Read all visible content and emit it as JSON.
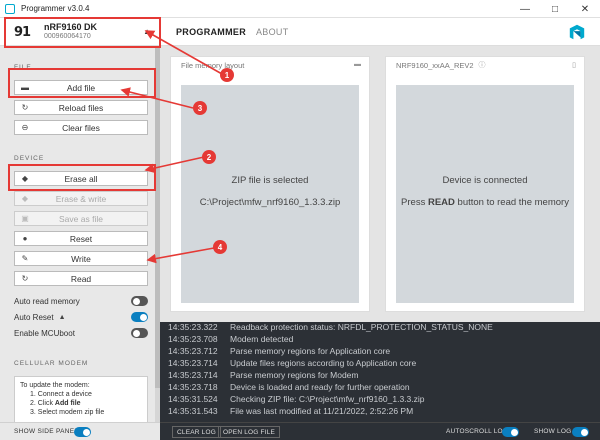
{
  "window": {
    "title": "Programmer v3.0.4",
    "controls": [
      "—",
      "□",
      "✕"
    ]
  },
  "device": {
    "logo": "91",
    "name": "nRF9160 DK",
    "serial": "000960064170"
  },
  "nav": {
    "tabs": [
      {
        "label": "PROGRAMMER",
        "active": true
      },
      {
        "label": "ABOUT",
        "active": false
      }
    ]
  },
  "sidebar": {
    "file_label": "FILE",
    "file_buttons": [
      {
        "label": "Add file",
        "icon": "folder-icon"
      },
      {
        "label": "Reload files",
        "icon": "reload-icon"
      },
      {
        "label": "Clear files",
        "icon": "clear-icon"
      }
    ],
    "device_label": "DEVICE",
    "device_buttons": [
      {
        "label": "Erase all",
        "icon": "eraser-icon",
        "disabled": false
      },
      {
        "label": "Erase & write",
        "icon": "eraser-icon",
        "disabled": true
      },
      {
        "label": "Save as file",
        "icon": "save-icon",
        "disabled": true
      },
      {
        "label": "Reset",
        "icon": "dot-icon",
        "disabled": false
      },
      {
        "label": "Write",
        "icon": "pencil-icon",
        "disabled": false
      },
      {
        "label": "Read",
        "icon": "refresh-icon",
        "disabled": false
      }
    ],
    "toggles": [
      {
        "label": "Auto read memory",
        "on": false
      },
      {
        "label": "Auto Reset",
        "on": true
      },
      {
        "label": "Enable MCUboot",
        "on": false
      }
    ],
    "cellular_label": "CELLULAR MODEM",
    "cellular_text": {
      "line1": "To update the modem:",
      "line2": "1. Connect a device",
      "line3_prefix": "2. Click ",
      "line3_bold": "Add file",
      "line4": "3. Select modem zip file"
    },
    "show_side_panel": "SHOW SIDE PANEL"
  },
  "cards": {
    "left": {
      "title": "File memory layout",
      "line1": "ZIP file is selected",
      "line2": "C:\\Project\\mfw_nrf9160_1.3.3.zip"
    },
    "right": {
      "title": "NRF9160_xxAA_REV2",
      "line1": "Device is connected",
      "line2_prefix": "Press ",
      "line2_bold": "READ",
      "line2_suffix": " button to read the memory"
    }
  },
  "log": {
    "entries": [
      {
        "time": "14:35:23.322",
        "msg": "Readback protection status: NRFDL_PROTECTION_STATUS_NONE"
      },
      {
        "time": "14:35:23.708",
        "msg": "Modem detected"
      },
      {
        "time": "14:35:23.712",
        "msg": "Parse memory regions for Application core"
      },
      {
        "time": "14:35:23.714",
        "msg": "Update files regions according to Application core"
      },
      {
        "time": "14:35:23.714",
        "msg": "Parse memory regions for Modem"
      },
      {
        "time": "14:35:23.718",
        "msg": "Device is loaded and ready for further operation"
      },
      {
        "time": "14:35:31.524",
        "msg": "Checking ZIP file: C:\\Project\\mfw_nrf9160_1.3.3.zip"
      },
      {
        "time": "14:35:31.543",
        "msg": "File was last modified at 11/21/2022, 2:52:26 PM"
      }
    ],
    "clear_label": "CLEAR LOG",
    "open_label": "OPEN LOG FILE",
    "autoscroll_label": "AUTOSCROLL LOG",
    "show_log_label": "SHOW LOG"
  },
  "annotations": [
    "1",
    "2",
    "3",
    "4"
  ],
  "colors": {
    "annotation": "#e53935",
    "accent": "#0a7fc0",
    "log_bg": "#2c3036"
  }
}
